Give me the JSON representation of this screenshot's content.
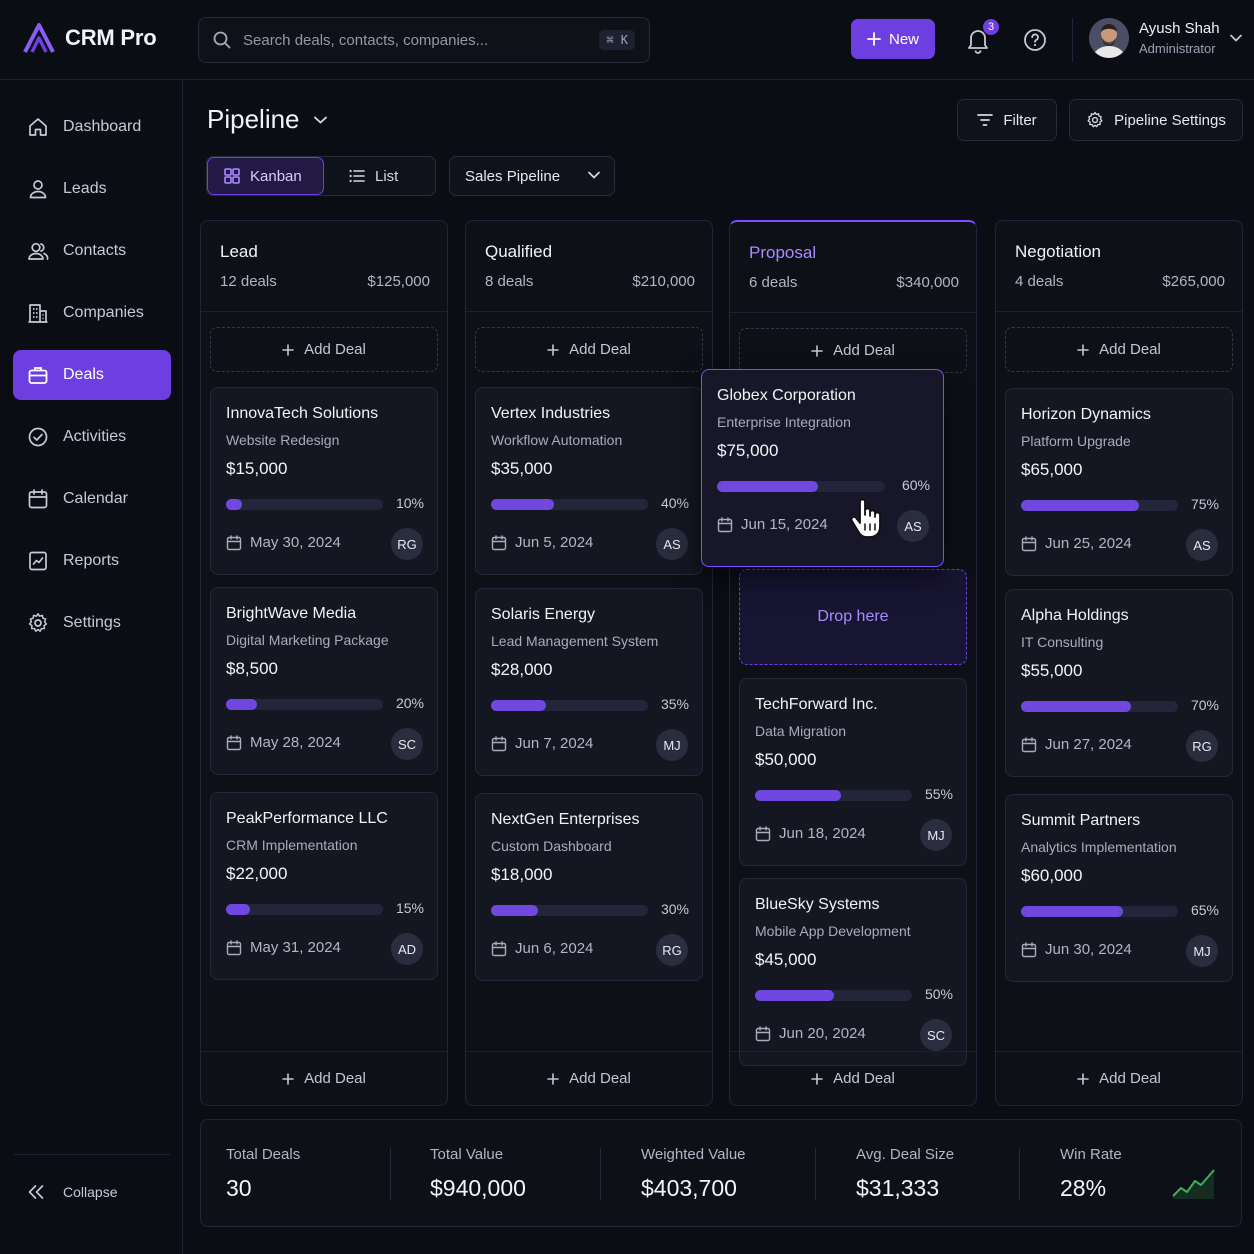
{
  "app": {
    "name": "CRM Pro",
    "brand_color": "#6d3fe0"
  },
  "header": {
    "search_placeholder": "Search deals, contacts, companies...",
    "search_shortcut": "⌘ K",
    "new_label": "New",
    "notification_count": "3",
    "user_name": "Ayush Shah",
    "user_role": "Administrator"
  },
  "sidebar": {
    "items": [
      {
        "label": "Dashboard",
        "icon": "home-icon"
      },
      {
        "label": "Leads",
        "icon": "user-icon"
      },
      {
        "label": "Contacts",
        "icon": "users-icon"
      },
      {
        "label": "Companies",
        "icon": "building-icon"
      },
      {
        "label": "Deals",
        "icon": "briefcase-icon",
        "active": true
      },
      {
        "label": "Activities",
        "icon": "check-circle-icon"
      },
      {
        "label": "Calendar",
        "icon": "calendar-icon"
      },
      {
        "label": "Reports",
        "icon": "report-icon"
      },
      {
        "label": "Settings",
        "icon": "gear-icon"
      }
    ],
    "collapse_label": "Collapse"
  },
  "page": {
    "title": "Pipeline",
    "filter_label": "Filter",
    "settings_label": "Pipeline Settings",
    "views": [
      "Kanban",
      "List"
    ],
    "active_view": "Kanban",
    "pipeline_select": "Sales Pipeline"
  },
  "columns": [
    {
      "name": "Lead",
      "count": "12 deals",
      "total": "$125,000",
      "add_label": "Add Deal",
      "cards": [
        {
          "company": "InnovaTech Solutions",
          "project": "Website Redesign",
          "amount": "$15,000",
          "progress": 10,
          "progress_label": "10%",
          "date": "May 30, 2024",
          "owner": "RG"
        },
        {
          "company": "BrightWave Media",
          "project": "Digital Marketing Package",
          "amount": "$8,500",
          "progress": 20,
          "progress_label": "20%",
          "date": "May 28, 2024",
          "owner": "SC"
        },
        {
          "company": "PeakPerformance LLC",
          "project": "CRM Implementation",
          "amount": "$22,000",
          "progress": 15,
          "progress_label": "15%",
          "date": "May 31, 2024",
          "owner": "AD"
        }
      ]
    },
    {
      "name": "Qualified",
      "count": "8 deals",
      "total": "$210,000",
      "add_label": "Add Deal",
      "cards": [
        {
          "company": "Vertex Industries",
          "project": "Workflow Automation",
          "amount": "$35,000",
          "progress": 40,
          "progress_label": "40%",
          "date": "Jun 5, 2024",
          "owner": "AS"
        },
        {
          "company": "Solaris Energy",
          "project": "Lead Management System",
          "amount": "$28,000",
          "progress": 35,
          "progress_label": "35%",
          "date": "Jun 7, 2024",
          "owner": "MJ"
        },
        {
          "company": "NextGen Enterprises",
          "project": "Custom Dashboard",
          "amount": "$18,000",
          "progress": 30,
          "progress_label": "30%",
          "date": "Jun 6, 2024",
          "owner": "RG"
        }
      ]
    },
    {
      "name": "Proposal",
      "count": "6 deals",
      "total": "$340,000",
      "add_label": "Add Deal",
      "drop_label": "Drop here",
      "dragging_card": {
        "company": "Globex Corporation",
        "project": "Enterprise Integration",
        "amount": "$75,000",
        "progress": 60,
        "progress_label": "60%",
        "date": "Jun 15, 2024",
        "owner": "AS"
      },
      "cards": [
        {
          "company": "TechForward Inc.",
          "project": "Data Migration",
          "amount": "$50,000",
          "progress": 55,
          "progress_label": "55%",
          "date": "Jun 18, 2024",
          "owner": "MJ"
        },
        {
          "company": "BlueSky Systems",
          "project": "Mobile App Development",
          "amount": "$45,000",
          "progress": 50,
          "progress_label": "50%",
          "date": "Jun 20, 2024",
          "owner": "SC"
        }
      ]
    },
    {
      "name": "Negotiation",
      "count": "4 deals",
      "total": "$265,000",
      "add_label": "Add Deal",
      "cards": [
        {
          "company": "Horizon Dynamics",
          "project": "Platform Upgrade",
          "amount": "$65,000",
          "progress": 75,
          "progress_label": "75%",
          "date": "Jun 25, 2024",
          "owner": "AS"
        },
        {
          "company": "Alpha Holdings",
          "project": "IT Consulting",
          "amount": "$55,000",
          "progress": 70,
          "progress_label": "70%",
          "date": "Jun 27, 2024",
          "owner": "RG"
        },
        {
          "company": "Summit Partners",
          "project": "Analytics Implementation",
          "amount": "$60,000",
          "progress": 65,
          "progress_label": "65%",
          "date": "Jun 30, 2024",
          "owner": "MJ"
        }
      ]
    }
  ],
  "stats": [
    {
      "label": "Total Deals",
      "value": "30"
    },
    {
      "label": "Total Value",
      "value": "$940,000"
    },
    {
      "label": "Weighted Value",
      "value": "$403,700"
    },
    {
      "label": "Avg. Deal Size",
      "value": "$31,333"
    },
    {
      "label": "Win Rate",
      "value": "28%"
    }
  ],
  "colors": {
    "accent": "#6d3fe0",
    "accent_light": "#a98bff",
    "positive": "#3fae5a"
  }
}
